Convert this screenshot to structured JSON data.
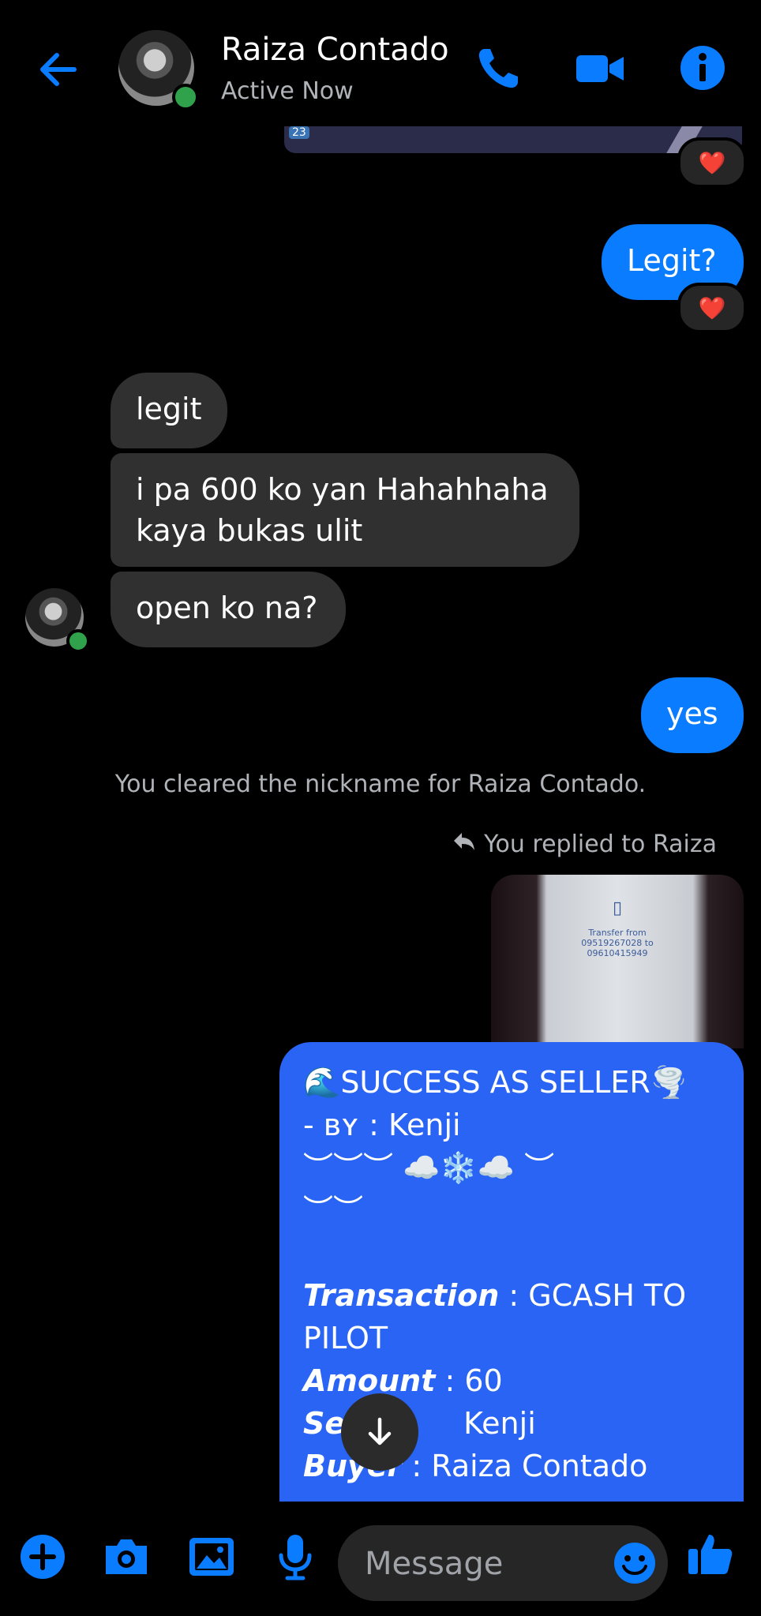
{
  "header": {
    "contact_name": "Raiza Contado",
    "status": "Active Now"
  },
  "top_image": {
    "badge": "23"
  },
  "messages": [
    {
      "side": "out",
      "text": "Legit?",
      "reaction": "❤️"
    },
    {
      "side": "in",
      "text": "legit"
    },
    {
      "side": "in",
      "line1": "i pa 600 ko yan Hahahhaha",
      "line2": "kaya bukas ulit"
    },
    {
      "side": "in",
      "text": "open ko na?"
    },
    {
      "side": "out",
      "text": "yes"
    }
  ],
  "top_reaction": "❤️",
  "system_note": "You cleared the nickname for Raiza Contado.",
  "reply_note": "You replied to Raiza",
  "reply_image": {
    "line1": "Transfer from",
    "line2": "09519267028 to",
    "line3": "09610415949"
  },
  "seller_message": {
    "title": "🌊SUCCESS AS SELLER🌪️",
    "by": "- ʙʏ : Kenji",
    "deco1": "︶︶︶ ☁️❄️☁️ ︶",
    "deco2": "︶︶",
    "transaction_label": "Transaction",
    "transaction_value": " : GCASH TO",
    "transaction_value2": "PILOT",
    "amount_label": "Amount",
    "amount_value": " : 60",
    "seller_label": "Se",
    "seller_value": "Kenji",
    "buyer_label": "Buyer",
    "buyer_value": " : Raiza Contado"
  },
  "composer": {
    "placeholder": "Message"
  },
  "colors": {
    "accent": "#0a7cff",
    "outgoing_bubble": "#0a7cff",
    "incoming_bubble": "#303030",
    "seller_bubble": "#2a64f5",
    "online": "#31a24c"
  }
}
